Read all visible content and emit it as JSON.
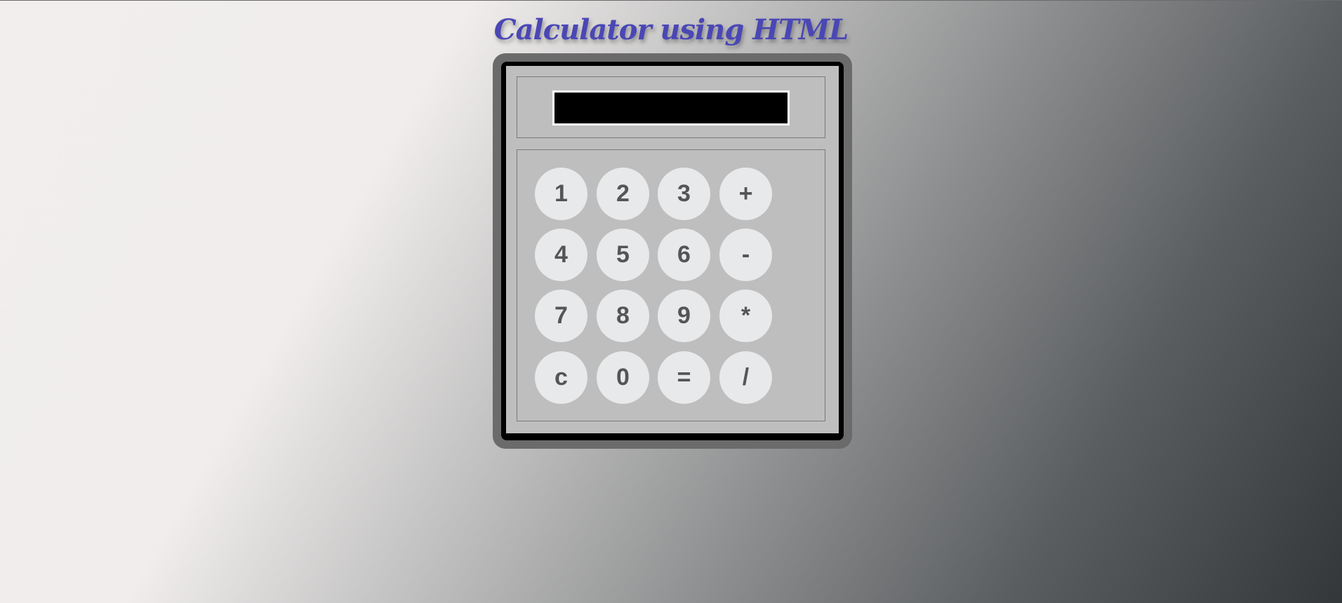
{
  "page": {
    "title": "Calculator using HTML"
  },
  "display": {
    "value": ""
  },
  "keys": {
    "row1": [
      "1",
      "2",
      "3",
      "+"
    ],
    "row2": [
      "4",
      "5",
      "6",
      "-"
    ],
    "row3": [
      "7",
      "8",
      "9",
      "*"
    ],
    "row4": [
      "c",
      "0",
      "=",
      "/"
    ]
  },
  "colors": {
    "title": "#4a47b5",
    "display_bg": "#000000",
    "key_bg": "#e8e9eb",
    "key_text": "#555555",
    "panel_bg": "#bebebe"
  }
}
